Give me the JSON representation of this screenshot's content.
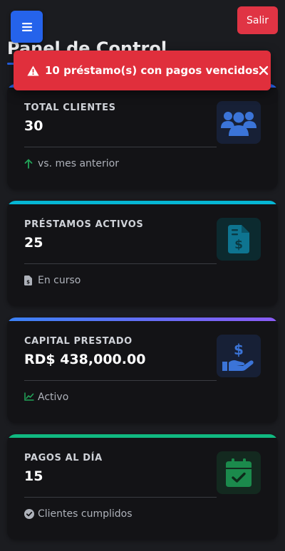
{
  "header": {
    "menu_icon": "hamburger-icon",
    "logout_label": "Salir",
    "page_title": "Panel de Control"
  },
  "alert": {
    "icon": "warning-triangle-icon",
    "message": "10 préstamo(s) con pagos vencidos",
    "close_icon": "close-icon"
  },
  "cards": [
    {
      "label": "TOTAL CLIENTES",
      "value": "30",
      "footer": "vs. mes anterior",
      "footer_icon": "arrow-up-icon",
      "icon": "users-icon",
      "accent_color": "#2563eb"
    },
    {
      "label": "PRÉSTAMOS ACTIVOS",
      "value": "25",
      "footer": "En curso",
      "footer_icon": "invoice-dollar-icon",
      "icon": "invoice-dollar-icon",
      "accent_color": "#06b6d4"
    },
    {
      "label": "CAPITAL PRESTADO",
      "value": "RD$ 438,000.00",
      "footer": "Activo",
      "footer_icon": "chart-line-icon",
      "icon": "hand-holding-dollar-icon",
      "accent_color": "#6366f1"
    },
    {
      "label": "PAGOS AL DÍA",
      "value": "15",
      "footer": "Clientes cumplidos",
      "footer_icon": "check-circle-icon",
      "icon": "calendar-check-icon",
      "accent_color": "#10b981"
    }
  ],
  "colors": {
    "background": "#1b1c20",
    "card": "#131316",
    "primary": "#2563eb",
    "danger": "#e03444",
    "success": "#22a559",
    "cyan": "#0e7490"
  }
}
